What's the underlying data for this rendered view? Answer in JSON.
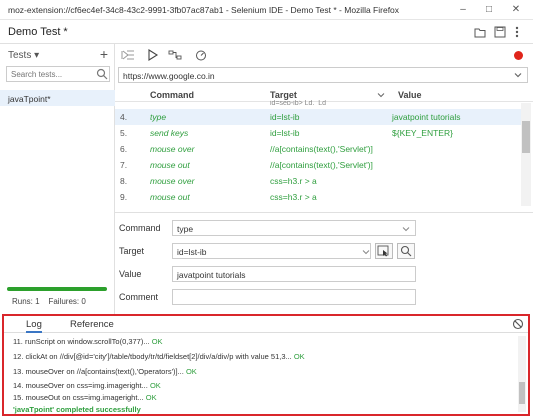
{
  "window": {
    "title": "moz-extension://cf6ec4ef-34c8-43c2-9991-3fb07ac87ab1 - Selenium IDE - Demo Test * - Mozilla Firefox"
  },
  "project": {
    "name": "Demo Test *"
  },
  "sidebar": {
    "heading": "Tests",
    "search_placeholder": "Search tests...",
    "tests": [
      {
        "label": "javaTpoint*"
      }
    ],
    "runs_label": "Runs: 1",
    "failures_label": "Failures: 0",
    "progress": 1.0
  },
  "url": {
    "value": "https://www.google.co.in"
  },
  "grid": {
    "headers": {
      "command": "Command",
      "target": "Target",
      "value": "Value"
    },
    "partial_row": "id=sep-ib> Ld,_Ld_",
    "rows": [
      {
        "num": "4.",
        "command": "type",
        "target": "id=lst-ib",
        "value": "javatpoint tutorials",
        "selected": true
      },
      {
        "num": "5.",
        "command": "send keys",
        "target": "id=lst-ib",
        "value": "${KEY_ENTER}",
        "selected": false
      },
      {
        "num": "6.",
        "command": "mouse over",
        "target": "//a[contains(text(),'Servlet')]",
        "value": "",
        "selected": false
      },
      {
        "num": "7.",
        "command": "mouse out",
        "target": "//a[contains(text(),'Servlet')]",
        "value": "",
        "selected": false
      },
      {
        "num": "8.",
        "command": "mouse over",
        "target": "css=h3.r > a",
        "value": "",
        "selected": false
      },
      {
        "num": "9.",
        "command": "mouse out",
        "target": "css=h3.r > a",
        "value": "",
        "selected": false
      }
    ]
  },
  "editor": {
    "command_label": "Command",
    "command_value": "type",
    "target_label": "Target",
    "target_value": "id=lst-ib",
    "value_label": "Value",
    "value_value": "javatpoint tutorials",
    "comment_label": "Comment",
    "comment_value": ""
  },
  "log": {
    "tabs": [
      "Log",
      "Reference"
    ],
    "lines": [
      {
        "text": "11. runScript on window.scrollTo(0,377)...",
        "status": "OK"
      },
      {
        "text": "12. clickAt on //div[@id='city']/table/tbody/tr/td/fieldset[2]/div/a/div/p with value 51,3...",
        "status": "OK"
      },
      {
        "text": "13. mouseOver on //a[contains(text(),'Operators')]...",
        "status": "OK"
      },
      {
        "text": "14. mouseOver on css=img.imageright...",
        "status": "OK"
      },
      {
        "text": "15. mouseOut on css=img.imageright...",
        "status": "OK"
      }
    ],
    "summary": "'javaTpoint' completed successfully"
  },
  "colors": {
    "accent": "#3a76c4",
    "ok": "#2e9e3d",
    "record": "#e0251b",
    "highlight": "#d9262b"
  }
}
